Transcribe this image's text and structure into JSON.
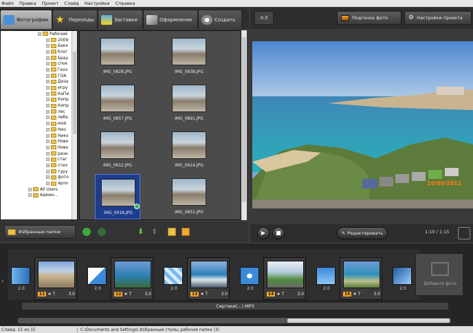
{
  "menu": [
    "Файл",
    "Правка",
    "Проект",
    "Слайд",
    "Настройки",
    "Справка"
  ],
  "tabs": [
    {
      "label": "Фотографии",
      "active": true,
      "icon": "photos-icon"
    },
    {
      "label": "Переходы",
      "active": false,
      "icon": "star-icon"
    },
    {
      "label": "Заставки",
      "active": false,
      "icon": "splash-icon"
    },
    {
      "label": "Оформление",
      "active": false,
      "icon": "brush-icon"
    },
    {
      "label": "Создать",
      "active": false,
      "icon": "film-icon"
    }
  ],
  "right_toolbar": {
    "ratio": "4:3",
    "full_photo": "Подгонка фото",
    "project_settings": "Настройки проекта"
  },
  "tree": {
    "items": [
      "Рабочий",
      "2009",
      "Бекк",
      "блог",
      "Брау",
      "спок",
      "Геоз",
      "ГОА",
      "Диза",
      "игру",
      "КаПи",
      "Кипр",
      "Кипр",
      "лес",
      "лебе",
      "мой",
      "Нео",
      "Нико",
      "Ново",
      "Ново",
      "разн",
      "стаг",
      "стих",
      "туру",
      "фото",
      "ярло",
      "All Users",
      "Админ..."
    ]
  },
  "thumbnails": [
    {
      "name": "IMG_0828.JPG",
      "selected": false
    },
    {
      "name": "IMG_0838.JPG",
      "selected": false
    },
    {
      "name": "IMG_0857.JPG",
      "selected": false
    },
    {
      "name": "IMG_0891.JPG",
      "selected": false
    },
    {
      "name": "IMG_0912.JPG",
      "selected": false
    },
    {
      "name": "IMG_0914.JPG",
      "selected": false
    },
    {
      "name": "IMG_0918.JPG",
      "selected": true
    },
    {
      "name": "IMG_0851.JPG",
      "selected": false
    }
  ],
  "left_toolbar": {
    "favorites": "Избранные папки"
  },
  "preview": {
    "datestamp": "10/09/2012",
    "edit": "Редактировать",
    "counter": "1:10 / 1:15"
  },
  "timeline": {
    "slides": [
      {
        "num": "11",
        "dur": "3.0"
      },
      {
        "num": "12",
        "dur": "3.0"
      },
      {
        "num": "13",
        "dur": "3.0"
      },
      {
        "num": "14",
        "dur": "3.0"
      },
      {
        "num": "15",
        "dur": "3.0"
      }
    ],
    "transitions": [
      "2.0",
      "2.0",
      "2.0",
      "2.0",
      "2.0",
      "2.0"
    ],
    "add_photo": "Добавьте фото",
    "audio": "Сиртаки(...).MP3"
  },
  "status": {
    "left": "Слайд: 15 из 15",
    "right": "C:\\Documents and Settings\\ Избранный стиль\\ рабочая папка (3)"
  },
  "colors": {
    "accent": "#f6a623",
    "selected": "#1e3d8f"
  }
}
